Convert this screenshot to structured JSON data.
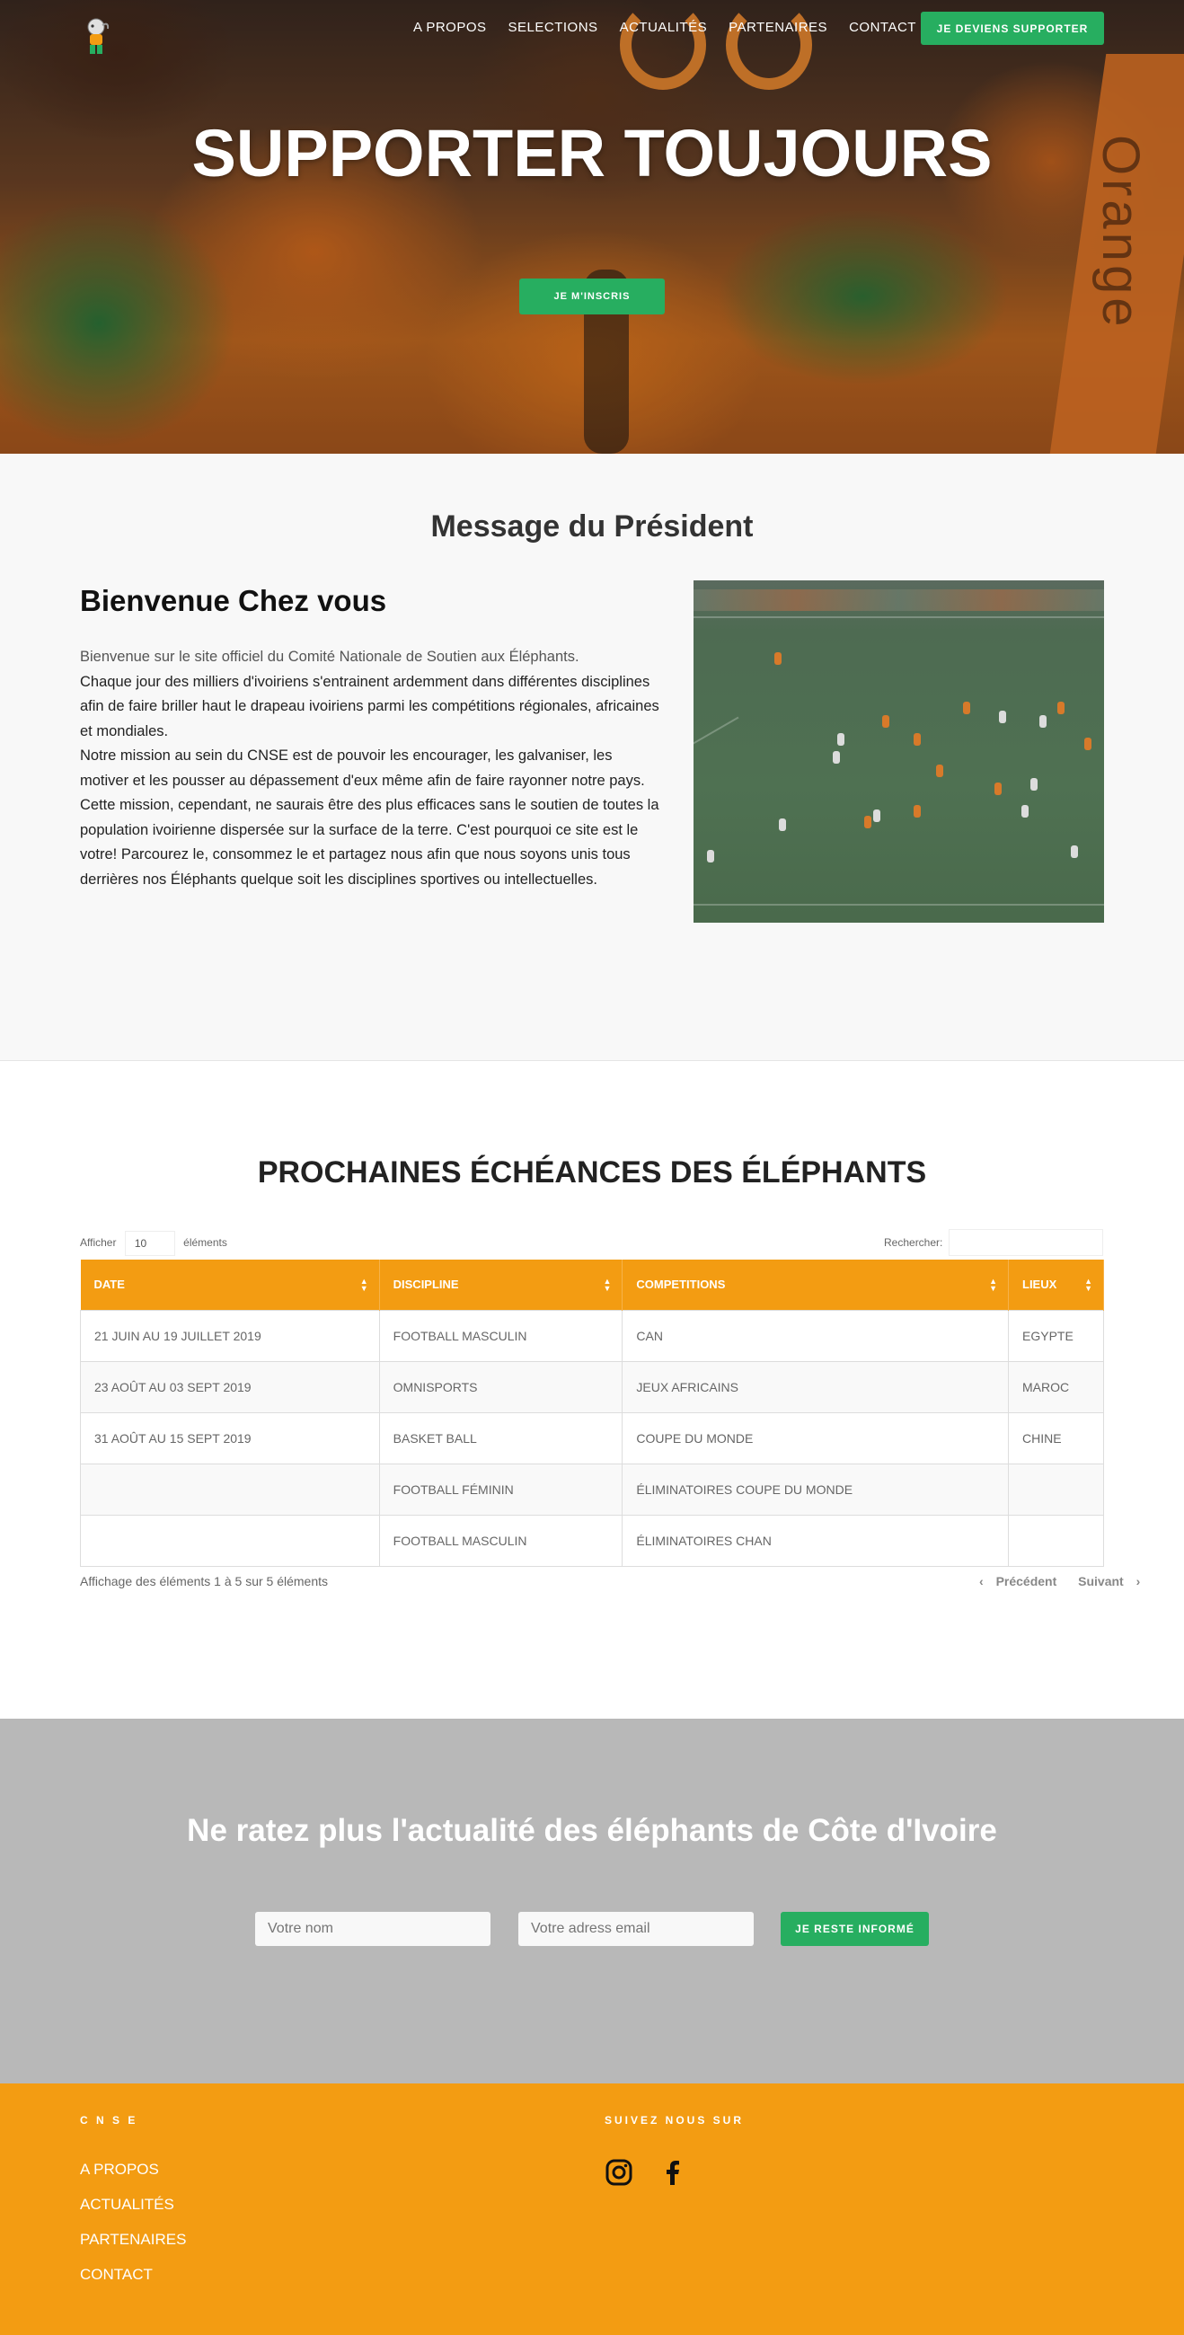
{
  "nav": {
    "items": [
      "A PROPOS",
      "SELECTIONS",
      "ACTUALITÉS",
      "PARTENAIRES",
      "CONTACT"
    ],
    "cta": "JE DEVIENS SUPPORTER"
  },
  "hero": {
    "title": "SUPPORTER TOUJOURS",
    "cta": "JE M'INSCRIS",
    "background_text": "Orange"
  },
  "president": {
    "section_title": "Message du Président",
    "heading": "Bienvenue Chez vous",
    "paragraphs": [
      "Bienvenue sur le site officiel du Comité Nationale de Soutien aux Éléphants.",
      "Chaque jour des milliers d'ivoiriens s'entrainent ardemment dans différentes disciplines  afin de faire briller haut le drapeau ivoiriens parmi les compétitions régionales, africaines et mondiales.",
      "Notre mission au sein du CNSE est de pouvoir les encourager, les galvaniser, les motiver et les pousser au dépassement d'eux même afin de faire rayonner  notre pays. Cette mission, cependant, ne saurais être des plus efficaces sans le soutien de toutes la population ivoirienne dispersée sur la surface de la terre. C'est pourquoi ce site est le votre! Parcourez le, consommez le et partagez nous afin que nous soyons unis tous derrières nos Éléphants quelque soit les disciplines sportives ou intellectuelles."
    ]
  },
  "schedule": {
    "title": "PROCHAINES ÉCHÉANCES DES ÉLÉPHANTS",
    "length_prefix": "Afficher",
    "length_value": "10",
    "length_suffix": "éléments",
    "search_label": "Rechercher:",
    "columns": [
      "DATE",
      "DISCIPLINE",
      "COMPETITIONS",
      "LIEUX"
    ],
    "rows": [
      [
        "21 JUIN AU 19 JUILLET 2019",
        "FOOTBALL MASCULIN",
        "CAN",
        "EGYPTE"
      ],
      [
        "23 AOÛT AU 03 SEPT 2019",
        "OMNISPORTS",
        "JEUX AFRICAINS",
        "MAROC"
      ],
      [
        "31 AOÛT AU 15 SEPT 2019",
        "BASKET BALL",
        "COUPE DU MONDE",
        "CHINE"
      ],
      [
        "",
        "FOOTBALL FÉMININ",
        "ÉLIMINATOIRES COUPE DU MONDE",
        ""
      ],
      [
        "",
        "FOOTBALL MASCULIN",
        "ÉLIMINATOIRES CHAN",
        ""
      ]
    ],
    "info": "Affichage des éléments 1 à 5 sur 5 éléments",
    "prev": "Précédent",
    "next": "Suivant"
  },
  "newsletter": {
    "title": "Ne ratez plus l'actualité des éléphants de  Côte d'Ivoire",
    "name_placeholder": "Votre nom",
    "email_placeholder": "Votre adress email",
    "button": "JE RESTE INFORMÉ"
  },
  "footer": {
    "col1_title": "C N S E",
    "links": [
      "A PROPOS",
      "ACTUALITÉS",
      "PARTENAIRES",
      "CONTACT"
    ],
    "col2_title": "SUIVEZ NOUS SUR",
    "social_icons": [
      "instagram-icon",
      "facebook-icon"
    ]
  },
  "colors": {
    "accent_orange": "#f39c12",
    "accent_green": "#27ae60",
    "newsletter_bg": "#b8b8b8"
  }
}
